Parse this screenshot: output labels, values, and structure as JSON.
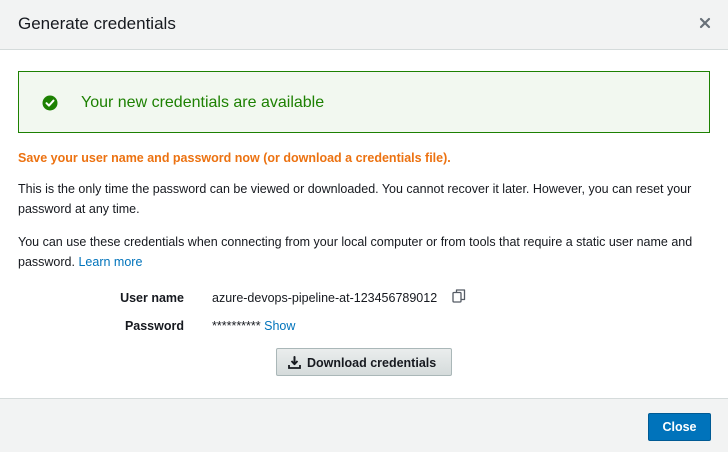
{
  "dialog": {
    "title": "Generate credentials",
    "close_icon": "close-icon"
  },
  "alert": {
    "icon": "check-circle-icon",
    "text": "Your new credentials are available",
    "color": "#1d8102"
  },
  "warning": {
    "text": "Save your user name and password now (or download a credentials file).",
    "color": "#ec7211"
  },
  "info": {
    "paragraph1": "This is the only time the password can be viewed or downloaded. You cannot recover it later. However, you can reset your password at any time.",
    "paragraph2": "You can use these credentials when connecting from your local computer or from tools that require a static user name and password.",
    "learn_more": "Learn more"
  },
  "credentials": {
    "username_label": "User name",
    "username_value": "azure-devops-pipeline-at-123456789012",
    "copy_icon": "copy-icon",
    "password_label": "Password",
    "password_value": "**********",
    "show_label": "Show"
  },
  "download": {
    "icon": "download-icon",
    "label": "Download credentials"
  },
  "footer": {
    "close_label": "Close",
    "primary_color": "#0073bb"
  }
}
